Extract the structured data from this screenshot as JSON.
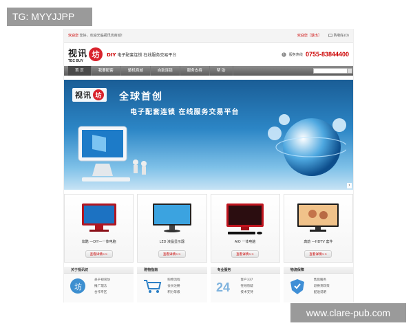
{
  "watermarks": {
    "top_left": "TG: MYYJJPP",
    "bottom_right": "www.clare-pub.com"
  },
  "topbar": {
    "login": "欢迎您",
    "greeting": "您好，欢迎光临视讯坊商城！",
    "user_link": "欢迎您［退出］",
    "cart": "购物车(0)"
  },
  "header": {
    "logo_cn": "视讯",
    "logo_badge": "坊",
    "logo_en": "TEC BUY",
    "slogan_diy": "DIY",
    "slogan_text": "电子配套连锁 在线服务交易平台",
    "hotline_label": "服务热线",
    "hotline_number": "0755-83844400"
  },
  "nav": {
    "items": [
      "首 页",
      "我要配套",
      "整机商城",
      "自助连锁",
      "服务支持",
      "帮 助"
    ],
    "active_index": 0
  },
  "banner": {
    "headline": "全球首创",
    "subline": "电子配套连锁  在线服务交易平台"
  },
  "products": [
    {
      "label": "炫酷 —DIY—一体电脑",
      "button": "查看详情>>"
    },
    {
      "label": "LED 液晶显示器",
      "button": "查看详情>>"
    },
    {
      "label": "AIO 一体电脑",
      "button": "查看详情>>"
    },
    {
      "label": "典韵 —HDTV 套件",
      "button": "查看详情>>"
    }
  ],
  "info_columns": [
    {
      "title": "关于视讯坊",
      "links": [
        "关于视讯坊",
        "推广理念",
        "合作专区"
      ]
    },
    {
      "title": "购物指南",
      "links": [
        "购物流程",
        "会员注册",
        "积分等级"
      ]
    },
    {
      "title": "专业服务",
      "links": [
        "客户337",
        "在线答疑",
        "技术支持"
      ]
    },
    {
      "title": "物流保障",
      "links": [
        "售后服务",
        "退换货政策",
        "配送说明"
      ]
    }
  ]
}
